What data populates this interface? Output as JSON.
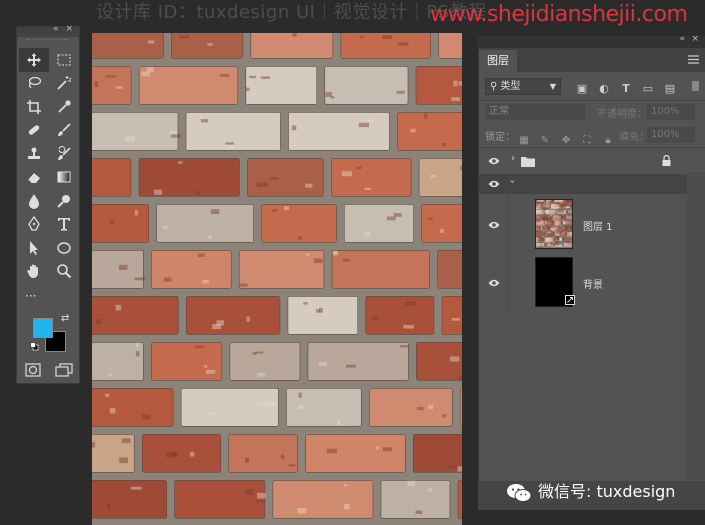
{
  "watermark_top": "设计库 ID：tuxdesign   UI｜视觉设计｜PS教程",
  "watermark_url": "www.shejidianshejii.com",
  "toolbox": {
    "tools": [
      "move",
      "marquee",
      "lasso",
      "magic-wand",
      "crop",
      "eyedropper",
      "healing",
      "brush",
      "stamp",
      "history-brush",
      "eraser",
      "gradient",
      "blur",
      "dodge",
      "pen",
      "type",
      "path-select",
      "shape",
      "hand",
      "zoom"
    ],
    "more_label": "···",
    "foreground_color": "#1fb6f0",
    "background_color": "#000000"
  },
  "layers_panel": {
    "tab_label": "图层",
    "kind_label": "类型",
    "blend_mode": "正常",
    "opacity_label": "不透明度：",
    "opacity_value": "100%",
    "lock_label": "锁定：",
    "fill_label": "填充：",
    "fill_value": "100%",
    "layers": [
      {
        "name": "",
        "type": "group"
      },
      {
        "name": "图层 1",
        "type": "bitmap"
      },
      {
        "name": "背景",
        "type": "background"
      }
    ]
  },
  "wechat_caption": "微信号: tuxdesign"
}
